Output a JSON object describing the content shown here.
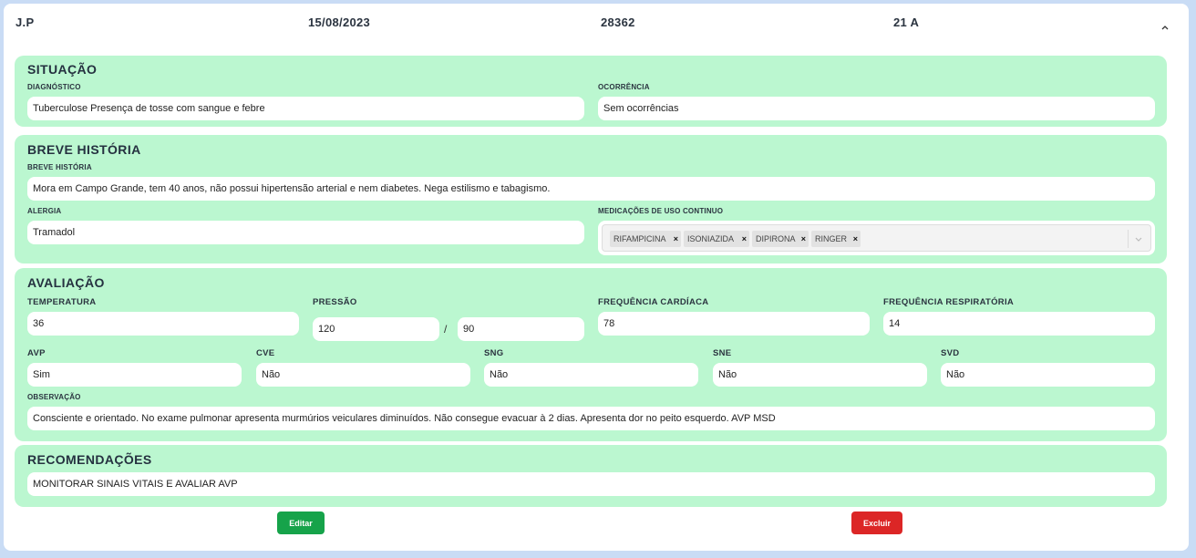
{
  "header": {
    "patient": "J.P",
    "date": "15/08/2023",
    "record_id": "28362",
    "bed": "21 A"
  },
  "situacao": {
    "title": "SITUAÇÃO",
    "diagnostico_label": "DIAGNÓSTICO",
    "diagnostico_value": "Tuberculose Presença de tosse com sangue e febre",
    "ocorrencia_label": "OCORRÊNCIA",
    "ocorrencia_value": "Sem ocorrências"
  },
  "historia": {
    "title": "BREVE HISTÓRIA",
    "breve_label": "BREVE HISTÓRIA",
    "breve_value": "Mora em Campo Grande, tem 40 anos, não possui hipertensão arterial e nem diabetes. Nega estilismo e tabagismo.",
    "alergia_label": "ALERGIA",
    "alergia_value": "Tramadol",
    "medicacoes_label": "MEDICAÇÕES DE USO CONTINUO",
    "medicacoes": [
      "RIFAMPICINA",
      "ISONIAZIDA",
      "DIPIRONA",
      "RINGER"
    ]
  },
  "avaliacao": {
    "title": "AVALIAÇÃO",
    "temperatura_label": "TEMPERATURA",
    "temperatura_value": "36",
    "pressao_label": "PRESSÃO",
    "pressao_sistolica": "120",
    "pressao_sep": "/",
    "pressao_diastolica": "90",
    "fc_label": "FREQUÊNCIA CARDÍACA",
    "fc_value": "78",
    "fr_label": "FREQUÊNCIA RESPIRATÓRIA",
    "fr_value": "14",
    "avp_label": "AVP",
    "avp_value": "Sim",
    "cve_label": "CVE",
    "cve_value": "Não",
    "sng_label": "SNG",
    "sng_value": "Não",
    "sne_label": "SNE",
    "sne_value": "Não",
    "svd_label": "SVD",
    "svd_value": "Não",
    "observacao_label": "OBSERVAÇÃO",
    "observacao_value": "Consciente e orientado. No exame pulmonar apresenta murmúrios veiculares diminuídos. Não consegue evacuar à 2 dias. Apresenta dor no peito esquerdo. AVP MSD"
  },
  "recomendacoes": {
    "title": "RECOMENDAÇÕES",
    "value": "MONITORAR SINAIS VITAIS E AVALIAR AVP"
  },
  "actions": {
    "edit_label": "Editar",
    "delete_label": "Excluir"
  },
  "colors": {
    "section_bg": "#bbf7d0",
    "edit_button": "#16a34a",
    "delete_button": "#dc2626",
    "page_bg": "#c9dcf5"
  },
  "icons": {
    "collapse": "chevron-up-icon",
    "dropdown": "chevron-down-icon",
    "chip_remove": "close-icon"
  }
}
